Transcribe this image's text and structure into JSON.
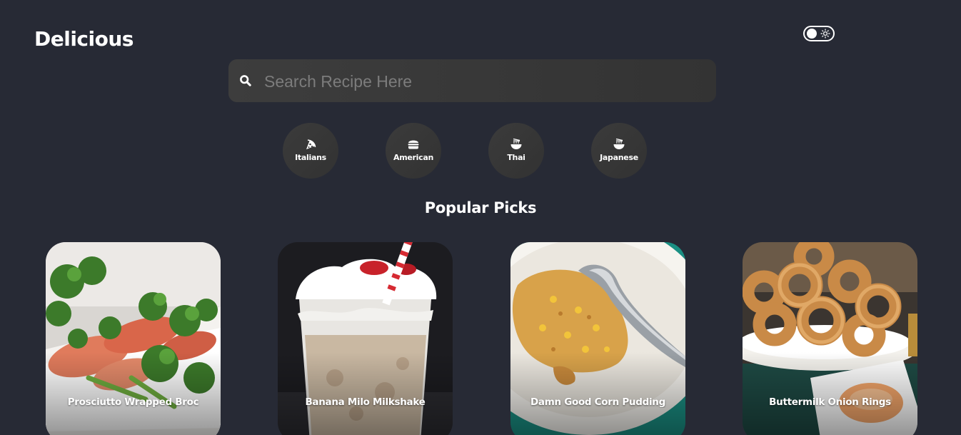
{
  "header": {
    "logo": "Delicious",
    "theme_toggle": {
      "state": "light-off",
      "icon": "sun-icon"
    }
  },
  "search": {
    "placeholder": "Search Recipe Here",
    "value": "",
    "icon": "search-icon"
  },
  "categories": [
    {
      "label": "Italians",
      "icon": "pizza-icon"
    },
    {
      "label": "American",
      "icon": "hamburger-icon"
    },
    {
      "label": "Thai",
      "icon": "noodle-bowl-icon"
    },
    {
      "label": "Japanese",
      "icon": "ramen-bowl-icon"
    }
  ],
  "popular": {
    "title": "Popular Picks",
    "recipes": [
      {
        "title": "Prosciutto Wrapped Broc",
        "image": "prosciutto-broccoli-photo"
      },
      {
        "title": "Banana Milo Milkshake",
        "image": "milkshake-photo"
      },
      {
        "title": "Damn Good Corn Pudding",
        "image": "corn-pudding-photo"
      },
      {
        "title": "Buttermilk Onion Rings",
        "image": "onion-rings-photo"
      }
    ]
  },
  "colors": {
    "background": "#272a35",
    "surface": "#3a3a3a",
    "text": "#ffffff",
    "placeholder": "#7c7c7c"
  }
}
